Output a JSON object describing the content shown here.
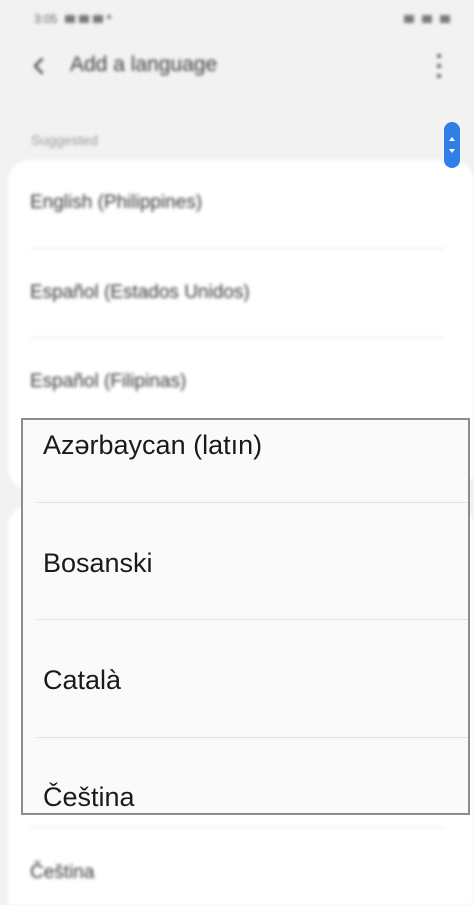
{
  "status_bar": {
    "time": "3:05"
  },
  "appbar": {
    "title": "Add a language"
  },
  "list": {
    "section_label": "Suggested",
    "suggested": [
      "English (Philippines)",
      "Español (Estados Unidos)",
      "Español (Filipinas)"
    ],
    "all_languages_bottom": "Čeština"
  },
  "magnifier": {
    "items": [
      "Azərbaycan (latın)",
      "Bosanski",
      "Català",
      "Čeština"
    ]
  },
  "colors": {
    "accent": "#2f7fe8",
    "background": "#f2f2f2",
    "card": "#ffffff"
  }
}
